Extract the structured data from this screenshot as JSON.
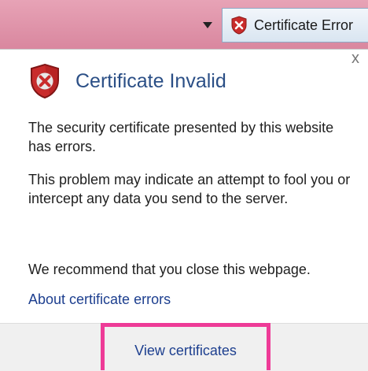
{
  "address_bar": {
    "dropdown_icon": "triangle-down-icon",
    "cert_error_tab": {
      "icon": "shield-error-icon",
      "label": "Certificate Error"
    }
  },
  "popup": {
    "close_icon": "close-icon",
    "close_glyph": "x",
    "title_icon": "shield-error-icon",
    "title": "Certificate Invalid",
    "paragraph_1": "The security certificate presented by this website has errors.",
    "paragraph_2": "This problem may indicate an attempt to fool you or intercept any data you send to the server.",
    "paragraph_3": "We recommend that you close this webpage.",
    "about_link": "About certificate errors",
    "view_certificates": "View certificates",
    "colors": {
      "title": "#2b4f86",
      "link": "#1d3f8f",
      "highlight_box": "#ee3b97",
      "address_bar": "#d9879f"
    }
  }
}
